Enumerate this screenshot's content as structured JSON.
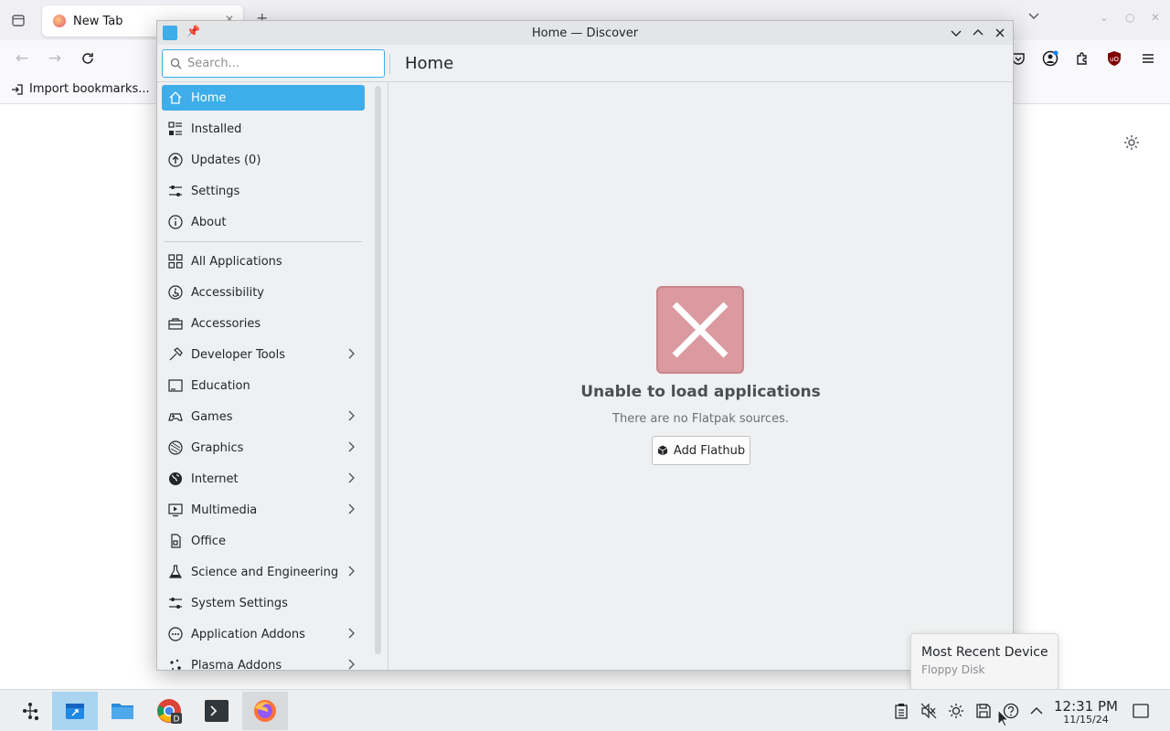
{
  "browser": {
    "tab_title": "New Tab",
    "bookmarks_import_label": "Import bookmarks..."
  },
  "window": {
    "title": "Home — Discover"
  },
  "search": {
    "placeholder": "Search..."
  },
  "header": {
    "page_title": "Home"
  },
  "sidebar": {
    "items": [
      {
        "label": "Home",
        "icon": "home-icon",
        "active": true
      },
      {
        "label": "Installed",
        "icon": "installed-list-icon"
      },
      {
        "label": "Updates (0)",
        "icon": "updates-icon"
      },
      {
        "label": "Settings",
        "icon": "settings-sliders-icon"
      },
      {
        "label": "About",
        "icon": "info-icon"
      }
    ],
    "categories": [
      {
        "label": "All Applications",
        "icon": "grid-icon",
        "has_children": false
      },
      {
        "label": "Accessibility",
        "icon": "accessibility-icon",
        "has_children": false
      },
      {
        "label": "Accessories",
        "icon": "toolbox-icon",
        "has_children": false
      },
      {
        "label": "Developer Tools",
        "icon": "hammer-icon",
        "has_children": true
      },
      {
        "label": "Education",
        "icon": "education-icon",
        "has_children": false
      },
      {
        "label": "Games",
        "icon": "gamepad-icon",
        "has_children": true
      },
      {
        "label": "Graphics",
        "icon": "palette-icon",
        "has_children": true
      },
      {
        "label": "Internet",
        "icon": "globe-icon",
        "has_children": true
      },
      {
        "label": "Multimedia",
        "icon": "multimedia-icon",
        "has_children": true
      },
      {
        "label": "Office",
        "icon": "office-icon",
        "has_children": false
      },
      {
        "label": "Science and Engineering",
        "icon": "flask-icon",
        "has_children": true
      },
      {
        "label": "System Settings",
        "icon": "system-settings-icon",
        "has_children": false
      },
      {
        "label": "Application Addons",
        "icon": "addons-icon",
        "has_children": true
      },
      {
        "label": "Plasma Addons",
        "icon": "plasma-icon",
        "has_children": true
      }
    ]
  },
  "main": {
    "error_title": "Unable to load applications",
    "error_subtitle": "There are no Flatpak sources.",
    "add_button_label": "Add Flathub"
  },
  "notification": {
    "title": "Most Recent Device",
    "body": "Floppy Disk"
  },
  "taskbar": {
    "apps": [
      "app-launcher",
      "discover",
      "dolphin",
      "chrome",
      "konsole",
      "firefox"
    ]
  },
  "clock": {
    "time": "12:31 PM",
    "date": "11/15/24"
  },
  "colors": {
    "accent": "#3daee9",
    "error_icon": "#da9aa0"
  }
}
